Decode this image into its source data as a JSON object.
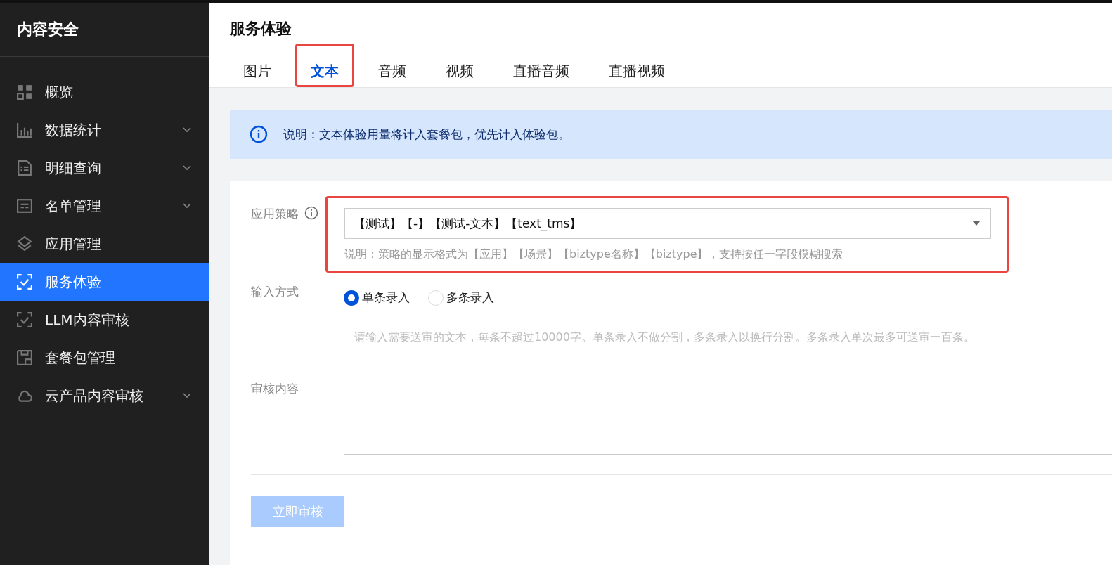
{
  "sidebar": {
    "title": "内容安全",
    "items": [
      {
        "label": "概览",
        "kind": "grid",
        "expandable": false,
        "selected": false
      },
      {
        "label": "数据统计",
        "kind": "chart",
        "expandable": true,
        "selected": false
      },
      {
        "label": "明细查询",
        "kind": "doc",
        "expandable": true,
        "selected": false
      },
      {
        "label": "名单管理",
        "kind": "list",
        "expandable": true,
        "selected": false
      },
      {
        "label": "应用管理",
        "kind": "layers",
        "expandable": false,
        "selected": false
      },
      {
        "label": "服务体验",
        "kind": "scan",
        "expandable": false,
        "selected": true
      },
      {
        "label": "LLM内容审核",
        "kind": "scan",
        "expandable": false,
        "selected": false
      },
      {
        "label": "套餐包管理",
        "kind": "package",
        "expandable": false,
        "selected": false
      },
      {
        "label": "云产品内容审核",
        "kind": "cloud",
        "expandable": true,
        "selected": false
      }
    ]
  },
  "page": {
    "title": "服务体验",
    "tabs": [
      {
        "label": "图片",
        "selected": false,
        "annotated": false
      },
      {
        "label": "文本",
        "selected": true,
        "annotated": true
      },
      {
        "label": "音频",
        "selected": false,
        "annotated": false
      },
      {
        "label": "视频",
        "selected": false,
        "annotated": false
      },
      {
        "label": "直播音频",
        "selected": false,
        "annotated": false
      },
      {
        "label": "直播视频",
        "selected": false,
        "annotated": false
      }
    ],
    "notice": "说明：文本体验用量将计入套餐包，优先计入体验包。"
  },
  "form": {
    "policy": {
      "label": "应用策略",
      "value": "【测试】【-】【测试-文本】【text_tms】",
      "hint": "说明：策略的显示格式为【应用】【场景】【biztype名称】【biztype】，支持按任一字段模糊搜索",
      "annotated": true
    },
    "input_mode": {
      "label": "输入方式",
      "options": [
        {
          "label": "单条录入",
          "selected": true
        },
        {
          "label": "多条录入",
          "selected": false
        }
      ]
    },
    "content": {
      "label": "审核内容",
      "placeholder": "请输入需要送审的文本，每条不超过10000字。单条录入不做分割，多条录入以换行分割。多条录入单次最多可送审一百条。"
    },
    "submit": {
      "label": "立即审核",
      "disabled": true
    }
  }
}
